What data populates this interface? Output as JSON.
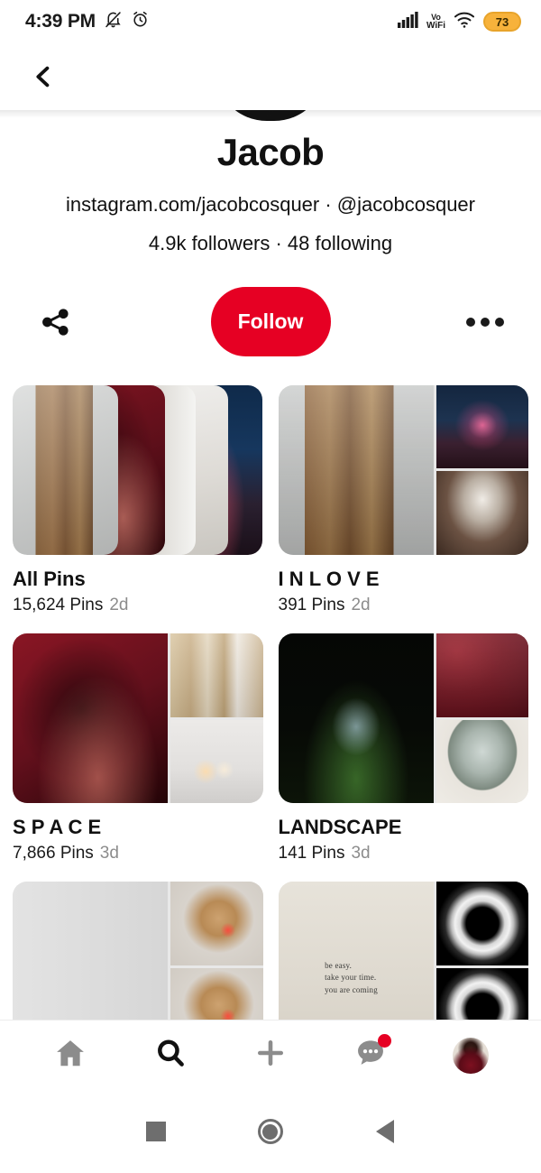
{
  "status_bar": {
    "time": "4:39 PM",
    "bell_icon": "bell-muted-icon",
    "alarm_icon": "alarm-clock-icon",
    "signal_icon": "cellular-signal-icon",
    "vowifi_line1": "Vo",
    "vowifi_line2": "WiFi",
    "wifi_icon": "wifi-icon",
    "battery_level": "73",
    "battery_color": "#F7B23B"
  },
  "app_bar": {
    "back_icon": "chevron-left-icon"
  },
  "profile": {
    "avatar": "profile-avatar",
    "name": "Jacob",
    "link_line": "instagram.com/jacobcosquer · @jacobcosquer",
    "stats": "4.9k followers · 48 following"
  },
  "actions": {
    "share_icon": "share-icon",
    "follow_label": "Follow",
    "follow_color": "#E60023",
    "more_icon": "more-horizontal-icon"
  },
  "boards": [
    {
      "title": "All Pins",
      "spaced": false,
      "pins": "15,624 Pins",
      "age": "2d",
      "layout": "deck",
      "images": [
        "im-wardrobe",
        "im-redarch",
        "im-whitedoor",
        "im-greyroom",
        "im-nightsky"
      ]
    },
    {
      "title": "I N L O V E",
      "spaced": false,
      "pins": "391 Pins",
      "age": "2d",
      "layout": "collage",
      "images": [
        "im-wardrobe2",
        "im-neonarch",
        "im-desertpod"
      ]
    },
    {
      "title": "S P A C E",
      "spaced": false,
      "pins": "7,866 Pins",
      "age": "3d",
      "layout": "collage",
      "images": [
        "im-redroom",
        "im-woodcloset",
        "im-lamps"
      ]
    },
    {
      "title": "LANDSCAPE",
      "spaced": false,
      "pins": "141 Pins",
      "age": "3d",
      "layout": "collage",
      "images": [
        "im-phonebooth",
        "im-redstairs",
        "im-archview"
      ]
    },
    {
      "title": "",
      "spaced": false,
      "pins": "",
      "age": "",
      "layout": "collage-partial",
      "images": [
        "im-grey-plain",
        "im-basket",
        "im-basket"
      ]
    },
    {
      "title": "",
      "spaced": false,
      "pins": "",
      "age": "",
      "layout": "collage-partial",
      "images": [
        "im-paper",
        "im-ring",
        "im-ring"
      ],
      "overlay_text": "be easy.\ntake your time.\nyou are coming"
    }
  ],
  "bottom_nav": [
    {
      "name": "home",
      "icon": "home-icon",
      "active": false
    },
    {
      "name": "search",
      "icon": "search-icon",
      "active": true
    },
    {
      "name": "create",
      "icon": "plus-icon",
      "active": false
    },
    {
      "name": "messages",
      "icon": "chat-bubble-icon",
      "active": false,
      "badge": true
    },
    {
      "name": "profile",
      "icon": "avatar-icon",
      "active": false
    }
  ],
  "system_nav": {
    "recents_icon": "square-recents-icon",
    "home_icon": "circle-home-icon",
    "back_icon": "triangle-back-icon"
  }
}
